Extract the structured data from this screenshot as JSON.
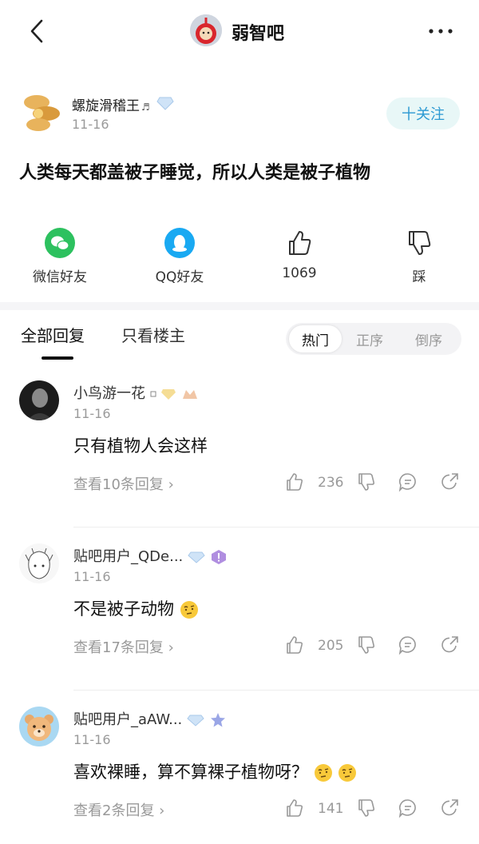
{
  "header": {
    "forum_name": "弱智吧",
    "back_icon": "chevron-left-icon",
    "more_icon": "more-dots-icon"
  },
  "post": {
    "author": "螺旋滑稽王",
    "author_note": "♬",
    "time": "11-16",
    "follow_label": "十关注",
    "title": "人类每天都盖被子睡觉，所以人类是被子植物"
  },
  "share": {
    "wechat_label": "微信好友",
    "qq_label": "QQ好友",
    "like_count": "1069",
    "dislike_label": "踩"
  },
  "tabs": {
    "all_replies": "全部回复",
    "op_only": "只看楼主",
    "sort_hot": "热门",
    "sort_asc": "正序",
    "sort_desc": "倒序"
  },
  "comments": [
    {
      "name": "小鸟游一花",
      "time": "11-16",
      "text": "只有植物人会这样",
      "more_replies": "查看10条回复 ›",
      "likes": "236"
    },
    {
      "name": "贴吧用户_QDe...",
      "time": "11-16",
      "text": "不是被子动物",
      "more_replies": "查看17条回复 ›",
      "likes": "205"
    },
    {
      "name": "贴吧用户_aAW...",
      "time": "11-16",
      "text": "喜欢裸睡，算不算裸子植物呀？",
      "more_replies": "查看2条回复 ›",
      "likes": "141"
    }
  ],
  "colors": {
    "accent_blue": "#2c9ad3",
    "wechat_green": "#2dc15f",
    "qq_blue": "#19a9f2",
    "muted": "#999999"
  }
}
